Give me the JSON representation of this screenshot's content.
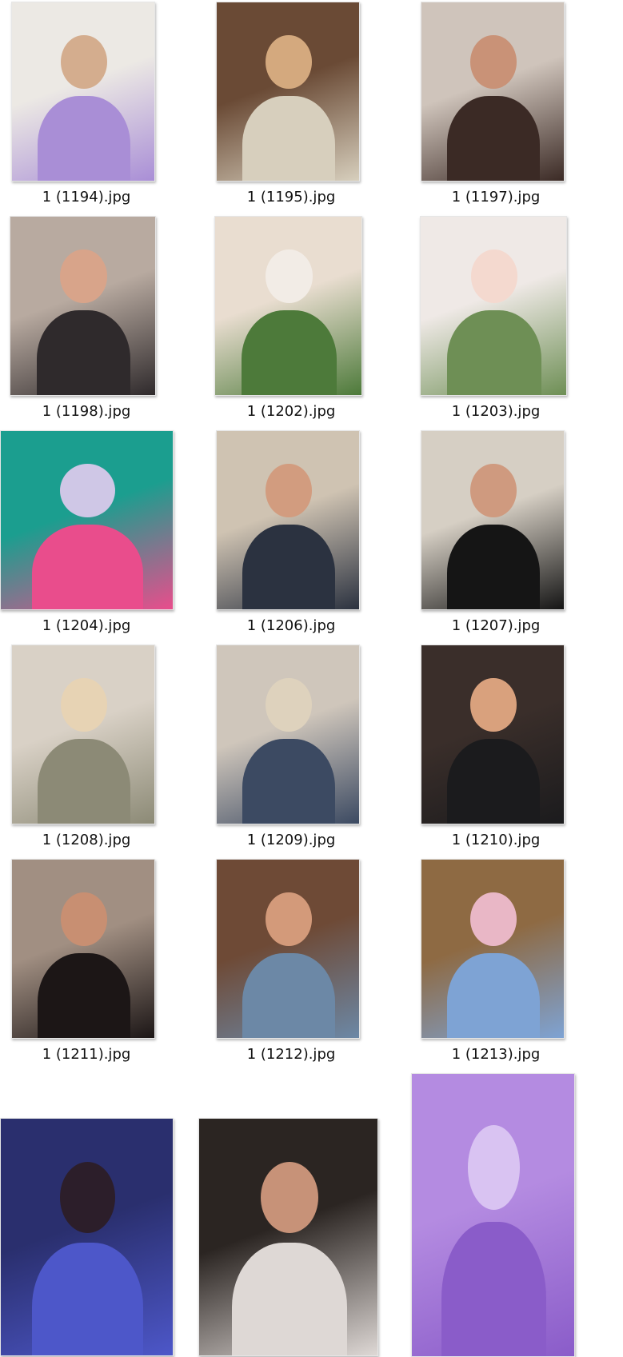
{
  "files": [
    {
      "name": "1 (1194).jpg",
      "colors": [
        "#ece9e4",
        "#a98ed6",
        "#d4ad8e"
      ]
    },
    {
      "name": "1 (1195).jpg",
      "colors": [
        "#6a4a35",
        "#d7cfbd",
        "#d4a97e"
      ]
    },
    {
      "name": "1 (1197).jpg",
      "colors": [
        "#cfc4bb",
        "#3b2a25",
        "#c99277"
      ]
    },
    {
      "name": "1 (1198).jpg",
      "colors": [
        "#b8aaa0",
        "#2f2a2c",
        "#d8a48a"
      ]
    },
    {
      "name": "1 (1202).jpg",
      "colors": [
        "#e9ddd0",
        "#4d7a3a",
        "#f2ece6"
      ]
    },
    {
      "name": "1 (1203).jpg",
      "colors": [
        "#efe9e6",
        "#6e8f55",
        "#f4d9cf"
      ]
    },
    {
      "name": "1 (1204).jpg",
      "colors": [
        "#1b9e8f",
        "#e94d8c",
        "#cfc7e6"
      ]
    },
    {
      "name": "1 (1206).jpg",
      "colors": [
        "#cfc3b2",
        "#2b3240",
        "#d29c7f"
      ]
    },
    {
      "name": "1 (1207).jpg",
      "colors": [
        "#d6cfc4",
        "#151515",
        "#cf9a7f"
      ]
    },
    {
      "name": "1 (1208).jpg",
      "colors": [
        "#d9d1c6",
        "#8c8a76",
        "#e7d3b4"
      ]
    },
    {
      "name": "1 (1209).jpg",
      "colors": [
        "#cfc6bb",
        "#3c4a62",
        "#ded2bd"
      ]
    },
    {
      "name": "1 (1210).jpg",
      "colors": [
        "#3a2e2a",
        "#1b1b1d",
        "#d9a17d"
      ]
    },
    {
      "name": "1 (1211).jpg",
      "colors": [
        "#a18f82",
        "#1c1616",
        "#c88f72"
      ]
    },
    {
      "name": "1 (1212).jpg",
      "colors": [
        "#6e4a36",
        "#6c88a6",
        "#d39a7a"
      ]
    },
    {
      "name": "1 (1213).jpg",
      "colors": [
        "#8e6a43",
        "#7ea3d4",
        "#e9b7c6"
      ]
    },
    {
      "name": "",
      "colors": [
        "#2a2f6e",
        "#4d57c9",
        "#2c1e2a"
      ]
    },
    {
      "name": "",
      "colors": [
        "#2b2522",
        "#ded8d5",
        "#c79278"
      ]
    },
    {
      "name": "",
      "colors": [
        "#b48be1",
        "#8a5cc9",
        "#d9c3f2"
      ]
    }
  ]
}
